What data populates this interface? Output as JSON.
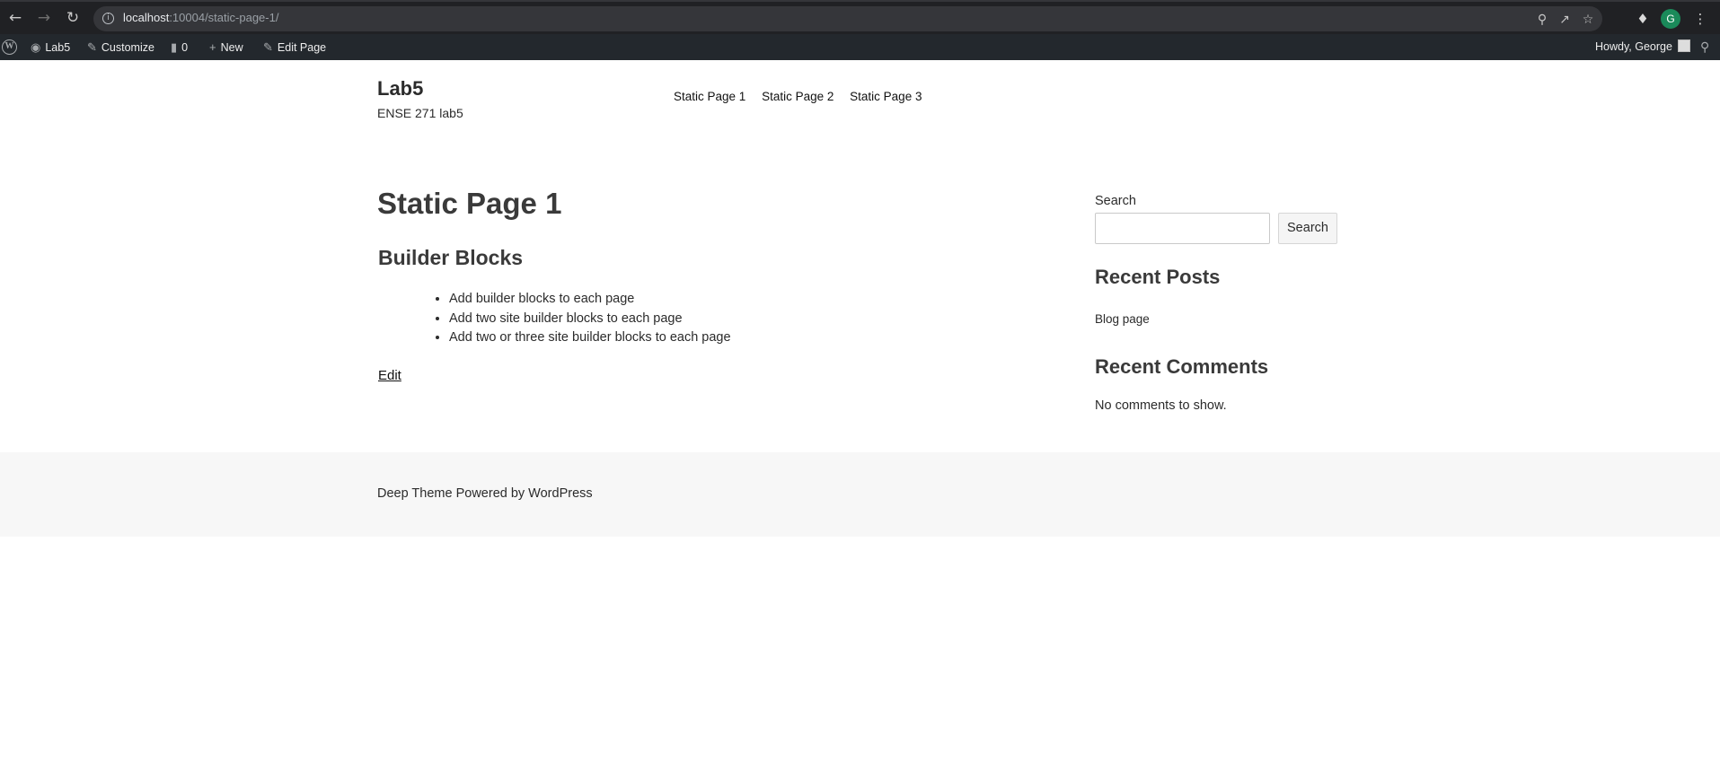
{
  "browser": {
    "url_host": "localhost",
    "url_rest": ":10004/static-page-1/",
    "profile_initial": "G"
  },
  "admin_bar": {
    "site_name": "Lab5",
    "customize": "Customize",
    "comments_count": "0",
    "new": "New",
    "edit_page": "Edit Page",
    "greeting": "Howdy, George"
  },
  "site": {
    "title": "Lab5",
    "description": "ENSE 271 lab5"
  },
  "nav": {
    "items": [
      {
        "label": "Static Page 1"
      },
      {
        "label": "Static Page 2"
      },
      {
        "label": "Static Page 3"
      }
    ]
  },
  "content": {
    "page_title": "Static Page 1",
    "section_title": "Builder Blocks",
    "list_items": [
      "Add builder blocks to each page",
      "Add two site builder blocks to each page",
      "Add two or three site builder blocks to each page"
    ],
    "edit_link": "Edit"
  },
  "sidebar": {
    "search_label": "Search",
    "search_value": "",
    "search_button": "Search",
    "recent_posts_title": "Recent Posts",
    "recent_posts": [
      "Blog page"
    ],
    "recent_comments_title": "Recent Comments",
    "no_comments": "No comments to show."
  },
  "footer": {
    "text": "Deep Theme Powered by WordPress"
  }
}
